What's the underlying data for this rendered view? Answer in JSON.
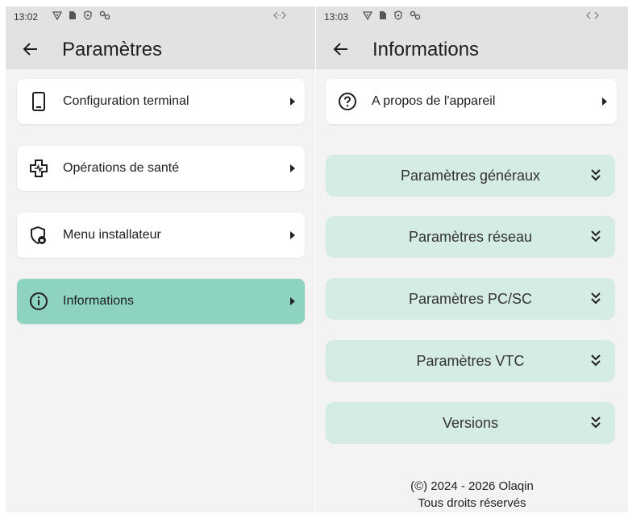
{
  "left_screen": {
    "status": {
      "time": "13:02"
    },
    "title": "Paramètres",
    "items": [
      {
        "label": "Configuration terminal",
        "icon": "phone-icon"
      },
      {
        "label": "Opérations de santé",
        "icon": "health-cross-icon"
      },
      {
        "label": "Menu installateur",
        "icon": "shield-lock-icon"
      },
      {
        "label": "Informations",
        "icon": "info-icon",
        "selected": true
      }
    ]
  },
  "right_screen": {
    "status": {
      "time": "13:03"
    },
    "title": "Informations",
    "about": {
      "label": "A propos de l'appareil",
      "icon": "help-circle-icon"
    },
    "sections": [
      {
        "label": "Paramètres généraux"
      },
      {
        "label": "Paramètres réseau"
      },
      {
        "label": "Paramètres PC/SC"
      },
      {
        "label": "Paramètres VTC"
      },
      {
        "label": "Versions"
      }
    ],
    "footer": {
      "line1": "(©) 2024 - 2026 Olaqin",
      "line2": "Tous droits réservés"
    }
  },
  "colors": {
    "selected_bg": "#8dd3c0",
    "section_bg": "#d4ece4",
    "bar_bg": "#e2e2e2"
  }
}
